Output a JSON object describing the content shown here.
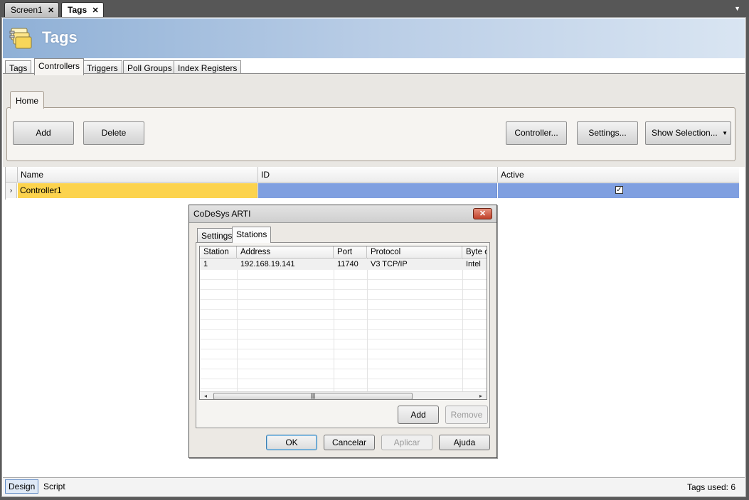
{
  "doc_tabs": [
    {
      "label": "Screen1",
      "close": "✕"
    },
    {
      "label": "Tags",
      "close": "✕"
    }
  ],
  "header": {
    "title": "Tags"
  },
  "subtabs": [
    "Tags",
    "Controllers",
    "Triggers",
    "Poll Groups",
    "Index Registers"
  ],
  "ribbon": {
    "tab": "Home",
    "buttons": {
      "add": "Add",
      "delete": "Delete",
      "controller": "Controller...",
      "settings": "Settings...",
      "show_selection": "Show Selection..."
    }
  },
  "grid": {
    "columns": [
      "Name",
      "ID",
      "Active"
    ],
    "rows": [
      {
        "indicator": "›",
        "name": "Controller1",
        "id": "",
        "active": true
      }
    ]
  },
  "dialog": {
    "title": "CoDeSys ARTI",
    "close": "✕",
    "tabs": [
      "Settings",
      "Stations"
    ],
    "columns": [
      "Station",
      "Address",
      "Port",
      "Protocol",
      "Byte o"
    ],
    "rows": [
      {
        "station": "1",
        "address": "192.168.19.141",
        "port": "11740",
        "protocol": "V3 TCP/IP",
        "byte_order": "Intel"
      }
    ],
    "scroll": {
      "left": "◂",
      "right": "▸",
      "grip": "|||"
    },
    "buttons": {
      "add": "Add",
      "remove": "Remove",
      "ok": "OK",
      "cancel": "Cancelar",
      "apply": "Aplicar",
      "help": "Ajuda"
    }
  },
  "statusbar": {
    "tabs": [
      "Design",
      "Script"
    ],
    "tags_used": "Tags used: 6"
  },
  "colors": {
    "header_gradient_start": "#8fb0d6",
    "selected_name_cell": "#fcd34d",
    "selected_row": "#7f9fe0"
  },
  "icons": {
    "header": "tags-folder-icon"
  }
}
